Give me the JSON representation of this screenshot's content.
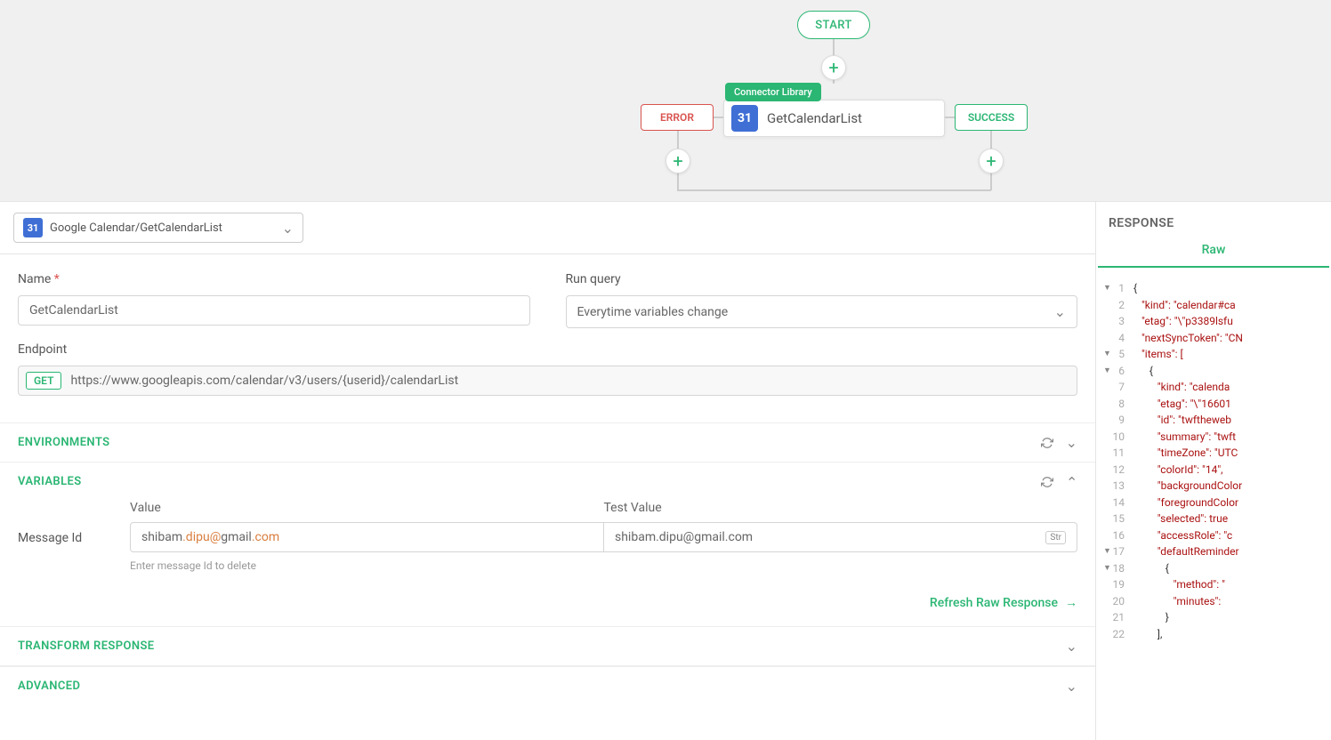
{
  "canvas": {
    "start_label": "START",
    "connector_badge": "Connector Library",
    "node_title": "GetCalendarList",
    "cal_icon_text": "31",
    "error_label": "ERROR",
    "success_label": "SUCCESS"
  },
  "selector": {
    "label": "Google Calendar/GetCalendarList",
    "icon_text": "31"
  },
  "form": {
    "name_label": "Name",
    "name_value": "GetCalendarList",
    "runquery_label": "Run query",
    "runquery_value": "Everytime variables change",
    "endpoint_label": "Endpoint",
    "method": "GET",
    "endpoint_url": "https://www.googleapis.com/calendar/v3/users/{userid}/calendarList"
  },
  "sections": {
    "environments": "ENVIRONMENTS",
    "variables": "VARIABLES",
    "transform": "TRANSFORM RESPONSE",
    "advanced": "ADVANCED"
  },
  "variables": {
    "value_header": "Value",
    "test_header": "Test Value",
    "row_label": "Message Id",
    "value": "shibam.dipu@gmail.com",
    "test_value": "shibam.dipu@gmail.com",
    "type_badge": "Str",
    "hint": "Enter message Id to delete",
    "refresh": "Refresh Raw Response"
  },
  "response": {
    "title": "RESPONSE",
    "tab": "Raw",
    "lines": [
      {
        "n": 1,
        "fold": true,
        "indent": 0,
        "text": "{"
      },
      {
        "n": 2,
        "indent": 1,
        "key": "\"kind\"",
        "rest": ": \"calendar#ca"
      },
      {
        "n": 3,
        "indent": 1,
        "key": "\"etag\"",
        "rest": ": \"\\\"p3389lsfu"
      },
      {
        "n": 4,
        "indent": 1,
        "key": "\"nextSyncToken\"",
        "rest": ": \"CN"
      },
      {
        "n": 5,
        "fold": true,
        "indent": 1,
        "key": "\"items\"",
        "rest": ": ["
      },
      {
        "n": 6,
        "fold": true,
        "indent": 2,
        "text": "{"
      },
      {
        "n": 7,
        "indent": 3,
        "key": "\"kind\"",
        "rest": ": \"calenda"
      },
      {
        "n": 8,
        "indent": 3,
        "key": "\"etag\"",
        "rest": ": \"\\\"16601"
      },
      {
        "n": 9,
        "indent": 3,
        "key": "\"id\"",
        "rest": ": \"twftheweb"
      },
      {
        "n": 10,
        "indent": 3,
        "key": "\"summary\"",
        "rest": ": \"twft"
      },
      {
        "n": 11,
        "indent": 3,
        "key": "\"timeZone\"",
        "rest": ": \"UTC"
      },
      {
        "n": 12,
        "indent": 3,
        "key": "\"colorId\"",
        "rest": ": \"14\","
      },
      {
        "n": 13,
        "indent": 3,
        "key": "\"backgroundColor"
      },
      {
        "n": 14,
        "indent": 3,
        "key": "\"foregroundColor"
      },
      {
        "n": 15,
        "indent": 3,
        "key": "\"selected\"",
        "rest": ": true"
      },
      {
        "n": 16,
        "indent": 3,
        "key": "\"accessRole\"",
        "rest": ": \"c"
      },
      {
        "n": 17,
        "fold": true,
        "indent": 3,
        "key": "\"defaultReminder"
      },
      {
        "n": 18,
        "fold": true,
        "indent": 4,
        "text": "{"
      },
      {
        "n": 19,
        "indent": 5,
        "key": "\"method\"",
        "rest": ": \""
      },
      {
        "n": 20,
        "indent": 5,
        "key": "\"minutes\"",
        "rest": ":"
      },
      {
        "n": 21,
        "indent": 4,
        "text": "}"
      },
      {
        "n": 22,
        "indent": 3,
        "text": "],"
      }
    ]
  }
}
